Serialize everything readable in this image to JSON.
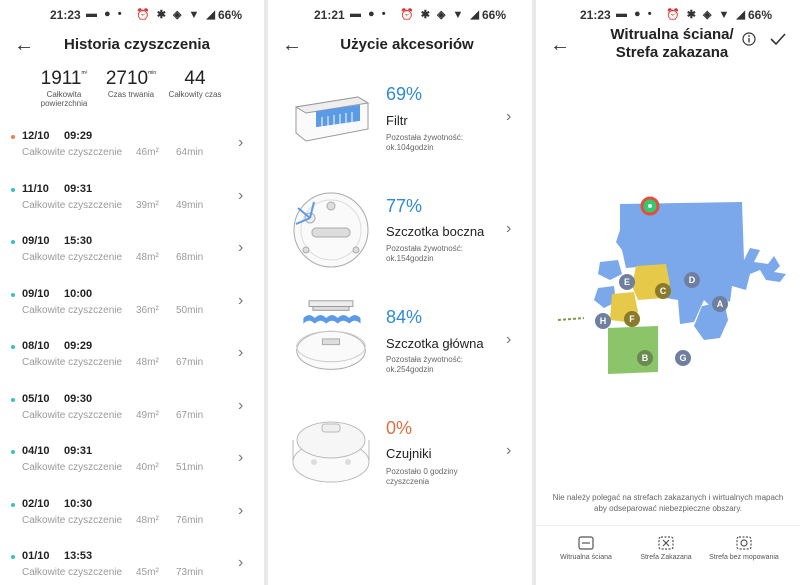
{
  "status_bars": [
    {
      "time": "21:23",
      "battery": "66%"
    },
    {
      "time": "21:21",
      "battery": "66%"
    },
    {
      "time": "21:23",
      "battery": "66%"
    }
  ],
  "history": {
    "title": "Historia czyszczenia",
    "stats": [
      {
        "value": "1911",
        "unit": "m²",
        "label": "Całkowita powierzchnia"
      },
      {
        "value": "2710",
        "unit": "min",
        "label": "Czas trwania"
      },
      {
        "value": "44",
        "unit": "",
        "label": "Całkowity czas"
      }
    ],
    "rows": [
      {
        "date": "12/10",
        "time": "09:29",
        "type": "Całkowite czyszczenie",
        "area": "46m²",
        "duration": "64min",
        "dot": "#f08040"
      },
      {
        "date": "11/10",
        "time": "09:31",
        "type": "Całkowite czyszczenie",
        "area": "39m²",
        "duration": "49min",
        "dot": "#3cc0c0"
      },
      {
        "date": "09/10",
        "time": "15:30",
        "type": "Całkowite czyszczenie",
        "area": "48m²",
        "duration": "68min",
        "dot": "#3cc0c0"
      },
      {
        "date": "09/10",
        "time": "10:00",
        "type": "Całkowite czyszczenie",
        "area": "36m²",
        "duration": "50min",
        "dot": "#3cc0c0"
      },
      {
        "date": "08/10",
        "time": "09:29",
        "type": "Całkowite czyszczenie",
        "area": "48m²",
        "duration": "67min",
        "dot": "#3cc0c0"
      },
      {
        "date": "05/10",
        "time": "09:30",
        "type": "Całkowite czyszczenie",
        "area": "49m²",
        "duration": "67min",
        "dot": "#3cc0c0"
      },
      {
        "date": "04/10",
        "time": "09:31",
        "type": "Całkowite czyszczenie",
        "area": "40m²",
        "duration": "51min",
        "dot": "#3cc0c0"
      },
      {
        "date": "02/10",
        "time": "10:30",
        "type": "Całkowite czyszczenie",
        "area": "48m²",
        "duration": "76min",
        "dot": "#3cc0c0"
      },
      {
        "date": "01/10",
        "time": "13:53",
        "type": "Całkowite czyszczenie",
        "area": "45m²",
        "duration": "73min",
        "dot": "#3cc0c0"
      }
    ]
  },
  "accessories": {
    "title": "Użycie akcesoriów",
    "items": [
      {
        "percent": "69%",
        "level": 0.69,
        "name": "Filtr",
        "note": "Pozostała żywotność: ok.104godzin",
        "color": "#2f8ad8",
        "icon": "filter-icon"
      },
      {
        "percent": "77%",
        "level": 0.77,
        "name": "Szczotka boczna",
        "note": "Pozostała żywotność: ok.154godzin",
        "color": "#2f8ad8",
        "icon": "side-brush-icon"
      },
      {
        "percent": "84%",
        "level": 0.84,
        "name": "Szczotka główna",
        "note": "Pozostała żywotność: ok.254godzin",
        "color": "#2f8ad8",
        "icon": "main-brush-icon"
      },
      {
        "percent": "0%",
        "level": 0,
        "name": "Czujniki",
        "note": "Pozostało 0 godziny czyszczenia",
        "color": "#e07040",
        "icon": "sensor-icon"
      }
    ]
  },
  "virtual_wall": {
    "title_line1": "Witrualna ściana/",
    "title_line2": "Strefa zakazana",
    "rooms": [
      "A",
      "B",
      "C",
      "D",
      "E",
      "F",
      "G",
      "H"
    ],
    "warning": "Nie należy polegać na strefach zakazanych i wirtualnych mapach aby odseparować niebezpieczne obszary.",
    "tabs": [
      {
        "label": "Witrualna ściana",
        "icon": "virtual-wall-icon"
      },
      {
        "label": "Strefa Zakazana",
        "icon": "no-go-zone-icon"
      },
      {
        "label": "Strefa bez mopowania",
        "icon": "no-mop-zone-icon"
      }
    ]
  }
}
